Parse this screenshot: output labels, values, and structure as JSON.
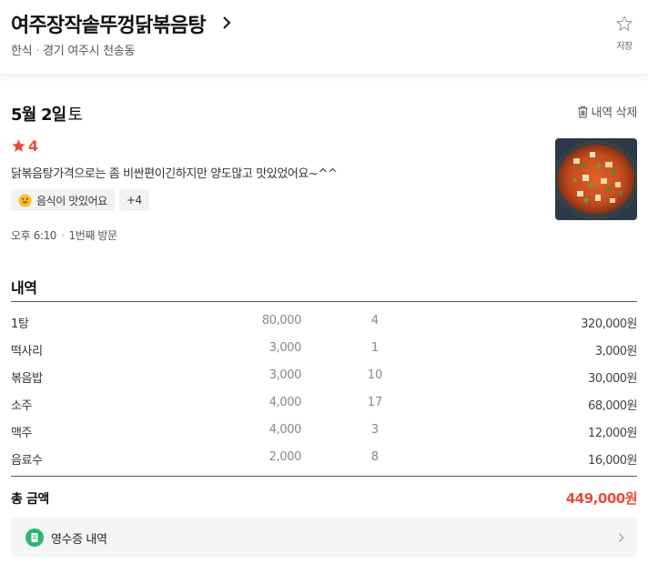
{
  "store": {
    "name": "여주장작솥뚜껑닭볶음탕",
    "category": "한식",
    "location": "경기 여주시 천송동"
  },
  "save": {
    "label": "저장"
  },
  "visit": {
    "date": "5월 2일",
    "weekday": "토",
    "delete_label": "내역 삭제",
    "time": "오후 6:10",
    "count": "1번째 방문"
  },
  "review": {
    "rating": "4",
    "text": "닭볶음탕가격으로는 좀 비싼편이긴하지만 양도많고 맛있었어요~^^",
    "tags": [
      {
        "label": "음식이 맛있어요",
        "icon": "smile-emoji-icon"
      },
      {
        "label": "+4"
      }
    ]
  },
  "items_section": {
    "title": "내역",
    "items": [
      {
        "name": "1탕",
        "price": "80,000",
        "qty": "4",
        "amount": "320,000원"
      },
      {
        "name": "떡사리",
        "price": "3,000",
        "qty": "1",
        "amount": "3,000원"
      },
      {
        "name": "볶음밥",
        "price": "3,000",
        "qty": "10",
        "amount": "30,000원"
      },
      {
        "name": "소주",
        "price": "4,000",
        "qty": "17",
        "amount": "68,000원"
      },
      {
        "name": "맥주",
        "price": "4,000",
        "qty": "3",
        "amount": "12,000원"
      },
      {
        "name": "음료수",
        "price": "2,000",
        "qty": "8",
        "amount": "16,000원"
      }
    ],
    "total_label": "총 금액",
    "total_amount": "449,000원"
  },
  "receipt": {
    "label": "영수증 내역"
  },
  "colors": {
    "accent_red": "#e84c3d",
    "receipt_green": "#2bb673"
  }
}
